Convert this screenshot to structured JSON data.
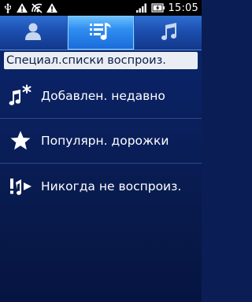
{
  "status_bar": {
    "icons": [
      "usb-icon",
      "warning-icon",
      "no-signal-icon",
      "warning-icon",
      "signal-icon",
      "battery-icon"
    ],
    "time": "15:05"
  },
  "tabs": [
    {
      "name": "artists",
      "icon": "person-icon",
      "active": false
    },
    {
      "name": "playlists",
      "icon": "playlist-icon",
      "active": true
    },
    {
      "name": "songs",
      "icon": "music-note-icon",
      "active": false
    }
  ],
  "section_header": "Специал.списки воспроиз.",
  "items": [
    {
      "label": "Добавлен. недавно",
      "icon": "recently-added-icon"
    },
    {
      "label": "Популярн. дорожки",
      "icon": "star-icon"
    },
    {
      "label": "Никогда не воспроиз.",
      "icon": "never-played-icon"
    }
  ],
  "colors": {
    "tab_active": "#2f8df0",
    "tab_bar": "#1c4fb0",
    "background": "#0a2160",
    "header_bg": "#eaeef4"
  }
}
